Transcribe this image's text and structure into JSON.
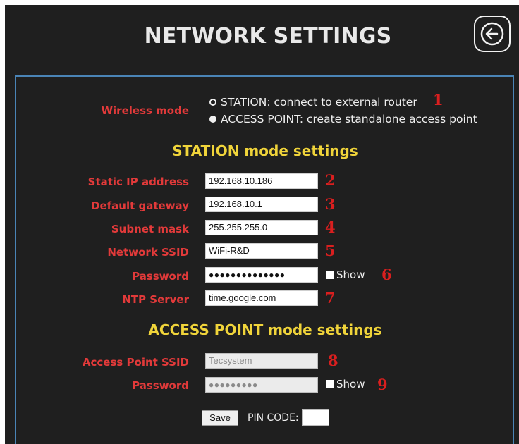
{
  "header": {
    "title": "NETWORK SETTINGS",
    "back_icon": "arrow-left-icon"
  },
  "wireless": {
    "label": "Wireless mode",
    "options": [
      {
        "label": "STATION: connect to external router",
        "selected": false
      },
      {
        "label": "ACCESS POINT: create standalone access point",
        "selected": true
      }
    ]
  },
  "station": {
    "heading": "STATION mode settings",
    "static_ip_label": "Static IP address",
    "static_ip": "192.168.10.186",
    "gateway_label": "Default gateway",
    "gateway": "192.168.10.1",
    "subnet_label": "Subnet mask",
    "subnet": "255.255.255.0",
    "ssid_label": "Network SSID",
    "ssid": "WiFi-R&D",
    "password_label": "Password",
    "password": "●●●●●●●●●●●●●●",
    "show_label": "Show",
    "ntp_label": "NTP Server",
    "ntp": "time.google.com"
  },
  "ap": {
    "heading": "ACCESS POINT mode settings",
    "ssid_label": "Access Point SSID",
    "ssid": "Tecsystem",
    "password_label": "Password",
    "password": "●●●●●●●●●",
    "show_label": "Show"
  },
  "footer": {
    "save_label": "Save",
    "pin_label": "PIN CODE:",
    "pin_value": ""
  },
  "annotations": [
    "1",
    "2",
    "3",
    "4",
    "5",
    "6",
    "7",
    "8",
    "9"
  ],
  "colors": {
    "background": "#1f1f1f",
    "label": "#e23a3a",
    "heading": "#f0d43a",
    "border": "#4a84b6",
    "annotation": "#d91f1f"
  }
}
